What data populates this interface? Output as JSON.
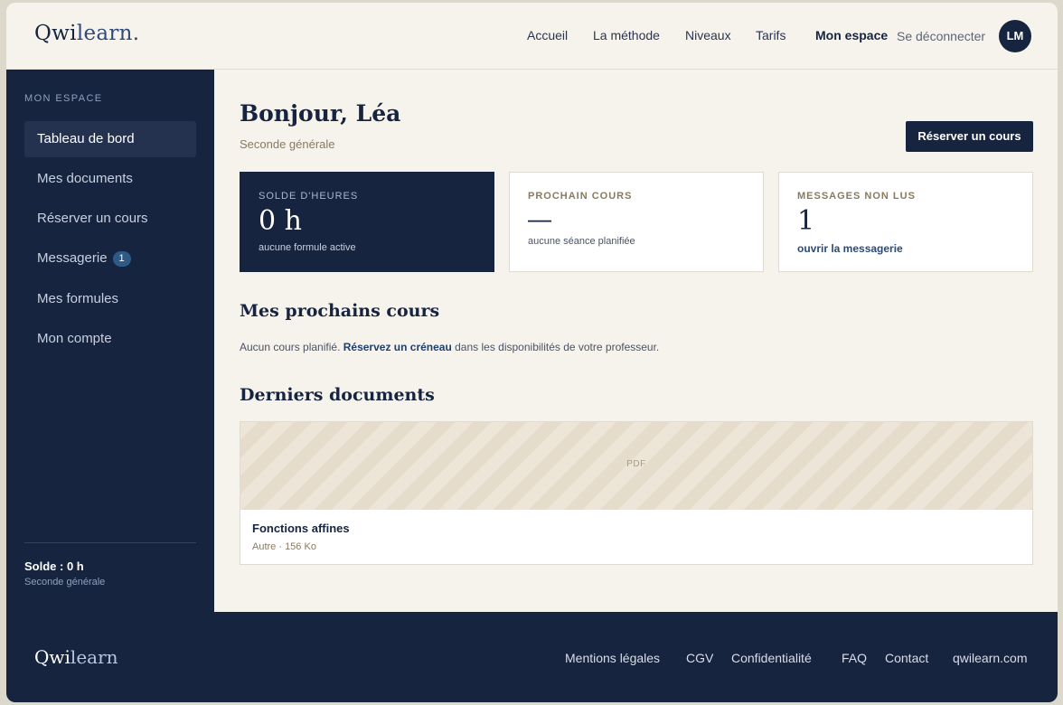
{
  "header": {
    "logo_main": "Qwi",
    "logo_accent": "learn.",
    "nav": [
      "Accueil",
      "La méthode",
      "Niveaux",
      "Tarifs"
    ],
    "my_space": "Mon espace",
    "logout": "Se déconnecter",
    "avatar_initials": "LM"
  },
  "sidebar": {
    "heading": "MON ESPACE",
    "items": [
      {
        "label": "Tableau de bord"
      },
      {
        "label": "Mes documents"
      },
      {
        "label": "Réserver un cours"
      },
      {
        "label": "Messagerie",
        "badge": "1"
      },
      {
        "label": "Mes formules"
      },
      {
        "label": "Mon compte"
      }
    ],
    "balance": "Solde : 0 h",
    "level": "Seconde générale"
  },
  "main": {
    "greeting": "Bonjour, Léa",
    "level": "Seconde générale",
    "book_button": "Réserver un cours",
    "cards": {
      "hours": {
        "label": "SOLDE D'HEURES",
        "value": "0 h",
        "note": "aucune formule active"
      },
      "next": {
        "label": "PROCHAIN COURS",
        "value": "—",
        "note": "aucune séance planifiée"
      },
      "messages": {
        "label": "MESSAGES NON LUS",
        "value": "1",
        "link": "ouvrir la messagerie"
      }
    },
    "upcoming_title": "Mes prochains cours",
    "upcoming_text_before": "Aucun cours planifié. ",
    "upcoming_link": "Réservez un créneau",
    "upcoming_text_after": " dans les disponibilités de votre professeur.",
    "docs_title": "Derniers documents",
    "doc": {
      "type": "PDF",
      "title": "Fonctions affines",
      "meta": "Autre · 156 Ko"
    }
  },
  "footer": {
    "logo_main": "Qwi",
    "logo_accent": "learn",
    "links": [
      "Mentions légales",
      "CGV",
      "Confidentialité",
      "FAQ",
      "Contact",
      "qwilearn.com"
    ]
  }
}
